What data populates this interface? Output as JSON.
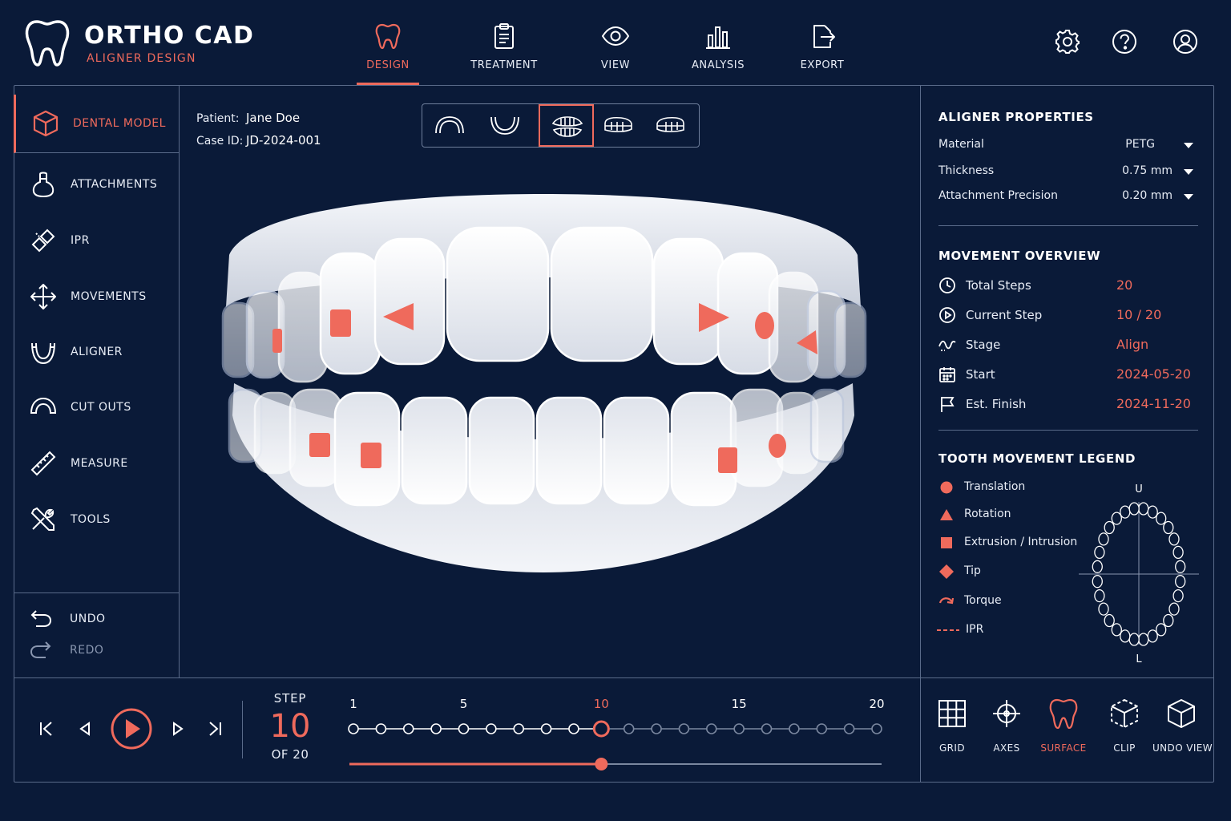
{
  "app": {
    "title": "ORTHO CAD",
    "subtitle": "ALIGNER DESIGN"
  },
  "nav": [
    {
      "label": "DESIGN",
      "icon": "tooth-icon",
      "active": true
    },
    {
      "label": "TREATMENT",
      "icon": "clipboard-icon"
    },
    {
      "label": "VIEW",
      "icon": "eye-icon"
    },
    {
      "label": "ANALYSIS",
      "icon": "bar-chart-icon"
    },
    {
      "label": "EXPORT",
      "icon": "export-icon"
    }
  ],
  "header_icons": [
    "gear-icon",
    "help-icon",
    "user-icon"
  ],
  "sidebar": {
    "items": [
      {
        "label": "DENTAL MODEL",
        "icon": "cube-icon",
        "active": true
      },
      {
        "label": "ATTACHMENTS",
        "icon": "attachment-icon"
      },
      {
        "label": "IPR",
        "icon": "ipr-icon"
      },
      {
        "label": "MOVEMENTS",
        "icon": "move-arrows-icon"
      },
      {
        "label": "ALIGNER",
        "icon": "aligner-icon"
      },
      {
        "label": "CUT OUTS",
        "icon": "cutout-icon"
      },
      {
        "label": "MEASURE",
        "icon": "ruler-icon"
      },
      {
        "label": "TOOLS",
        "icon": "tools-icon"
      }
    ],
    "undo": "UNDO",
    "redo": "REDO"
  },
  "patient": {
    "patient_label": "Patient:",
    "patient_name": "Jane Doe",
    "case_label": "Case ID:",
    "case_id": "JD-2024-001"
  },
  "view_modes": [
    {
      "icon": "upper-arch-icon"
    },
    {
      "icon": "lower-arch-icon"
    },
    {
      "icon": "both-arches-icon",
      "active": true
    },
    {
      "icon": "side-left-icon"
    },
    {
      "icon": "side-right-icon"
    }
  ],
  "aligner_properties": {
    "title": "ALIGNER PROPERTIES",
    "rows": [
      {
        "key": "Material",
        "value": "PETG"
      },
      {
        "key": "Thickness",
        "value": "0.75 mm"
      },
      {
        "key": "Attachment Precision",
        "value": "0.20 mm"
      }
    ]
  },
  "movement_overview": {
    "title": "MOVEMENT OVERVIEW",
    "rows": [
      {
        "key": "Total Steps",
        "value": "20",
        "icon": "clock-icon"
      },
      {
        "key": "Current Step",
        "value": "10 / 20",
        "icon": "play-circle-icon"
      },
      {
        "key": "Stage",
        "value": "Align",
        "icon": "wave-icon"
      },
      {
        "key": "Start",
        "value": "2024-05-20",
        "icon": "calendar-icon"
      },
      {
        "key": "Est. Finish",
        "value": "2024-11-20",
        "icon": "flag-icon"
      }
    ]
  },
  "legend": {
    "title": "TOOTH MOVEMENT LEGEND",
    "items": [
      {
        "key": "Translation",
        "icon": "circle-icon"
      },
      {
        "key": "Rotation",
        "icon": "triangle-icon"
      },
      {
        "key": "Extrusion / Intrusion",
        "icon": "square-icon"
      },
      {
        "key": "Tip",
        "icon": "diamond-icon"
      },
      {
        "key": "Torque",
        "icon": "curved-arrow-icon"
      },
      {
        "key": "IPR",
        "icon": "dashed-line-icon"
      }
    ],
    "arch_upper": "U",
    "arch_lower": "L"
  },
  "playback": {
    "step_label": "STEP",
    "current_step": "10",
    "of_label": "OF 20",
    "timeline_labels": [
      "1",
      "5",
      "10",
      "15",
      "20"
    ],
    "total_steps": 20,
    "current": 10
  },
  "bottom_tools": [
    {
      "label": "GRID",
      "icon": "grid-icon"
    },
    {
      "label": "AXES",
      "icon": "axes-icon"
    },
    {
      "label": "SURFACE",
      "icon": "tooth-icon",
      "active": true
    },
    {
      "label": "CLIP",
      "icon": "clip-icon"
    },
    {
      "label": "UNDO VIEW",
      "icon": "box-icon"
    }
  ],
  "colors": {
    "background": "#0a1a38",
    "accent": "#ef6a5c",
    "border": "#5a6b8a",
    "text": "#e8edf6"
  }
}
